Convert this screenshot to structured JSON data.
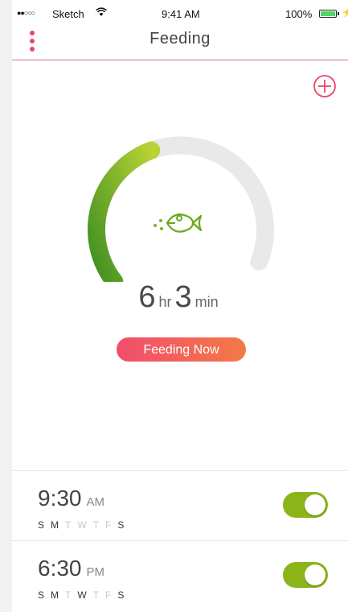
{
  "status_bar": {
    "signal": "●●○○○",
    "carrier": "Sketch",
    "time": "9:41 AM",
    "battery": "100%"
  },
  "header": {
    "title": "Feeding"
  },
  "timer": {
    "hours": "6",
    "hours_unit": "hr",
    "minutes": "3",
    "minutes_unit": "min",
    "progress_fraction": 0.42
  },
  "actions": {
    "feed_now_label": "Feeding Now"
  },
  "schedule": [
    {
      "time": "9:30",
      "period": "AM",
      "enabled": true,
      "days": [
        {
          "letter": "S",
          "active": true
        },
        {
          "letter": "M",
          "active": true
        },
        {
          "letter": "T",
          "active": false
        },
        {
          "letter": "W",
          "active": false
        },
        {
          "letter": "T",
          "active": false
        },
        {
          "letter": "F",
          "active": false
        },
        {
          "letter": "S",
          "active": true
        }
      ]
    },
    {
      "time": "6:30",
      "period": "PM",
      "enabled": true,
      "days": [
        {
          "letter": "S",
          "active": true
        },
        {
          "letter": "M",
          "active": true
        },
        {
          "letter": "T",
          "active": false
        },
        {
          "letter": "W",
          "active": true
        },
        {
          "letter": "T",
          "active": false
        },
        {
          "letter": "F",
          "active": false
        },
        {
          "letter": "S",
          "active": true
        }
      ]
    }
  ],
  "colors": {
    "accent_pink": "#ef4668",
    "gauge_green_start": "#3f8f22",
    "gauge_green_end": "#b9d334",
    "toggle_on": "#8bb418",
    "track": "#e9e9e9"
  },
  "icons": {
    "menu": "menu-dots-icon",
    "add": "plus-circle-icon",
    "fish": "fish-icon"
  }
}
